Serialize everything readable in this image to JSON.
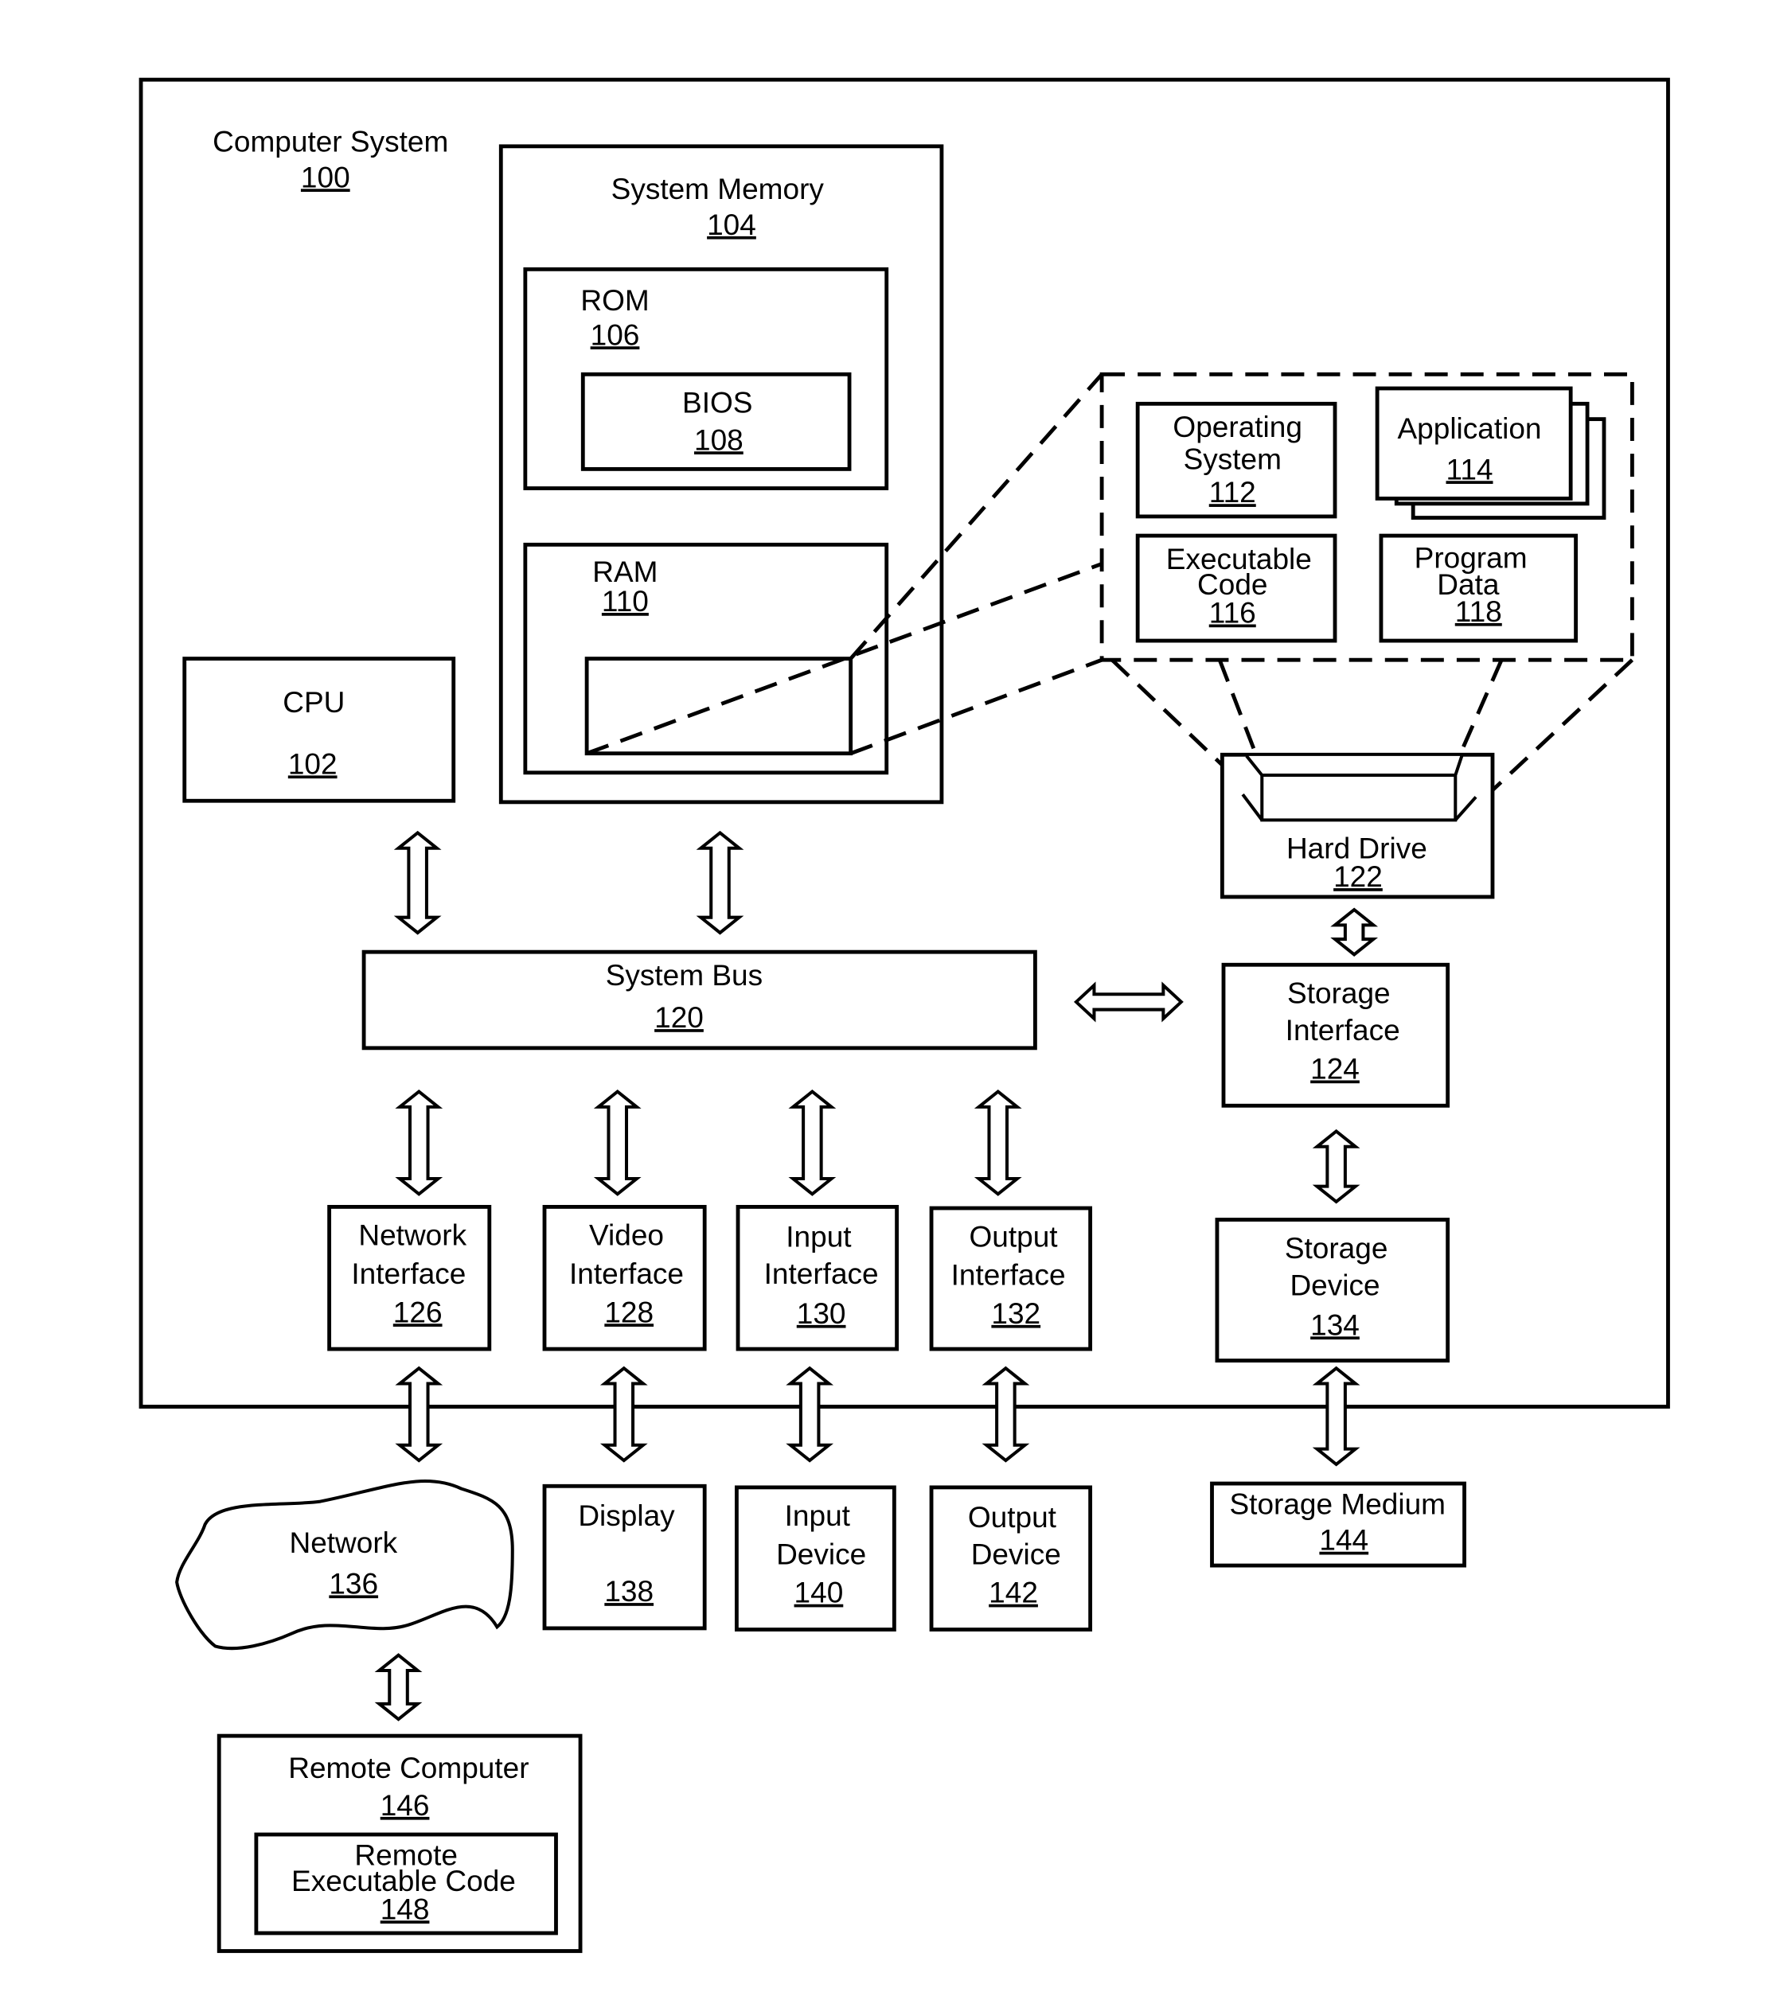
{
  "computer_system": {
    "label": "Computer System",
    "ref": "100"
  },
  "system_memory": {
    "label": "System Memory",
    "ref": "104"
  },
  "rom": {
    "label": "ROM",
    "ref": "106"
  },
  "bios": {
    "label": "BIOS",
    "ref": "108"
  },
  "ram": {
    "label": "RAM",
    "ref": "110"
  },
  "cpu": {
    "label": "CPU",
    "ref": "102"
  },
  "operating_system": {
    "line1": "Operating",
    "line2": "System",
    "ref": "112"
  },
  "application": {
    "label": "Application",
    "ref": "114"
  },
  "executable_code": {
    "line1": "Executable",
    "line2": "Code",
    "ref": "116"
  },
  "program_data": {
    "line1": "Program",
    "line2": "Data",
    "ref": "118"
  },
  "system_bus": {
    "label": "System Bus",
    "ref": "120"
  },
  "hard_drive": {
    "label": "Hard Drive",
    "ref": "122"
  },
  "storage_interface": {
    "line1": "Storage",
    "line2": "Interface",
    "ref": "124"
  },
  "network_interface": {
    "line1": "Network",
    "line2": "Interface",
    "ref": "126"
  },
  "video_interface": {
    "line1": "Video",
    "line2": "Interface",
    "ref": "128"
  },
  "input_interface": {
    "line1": "Input",
    "line2": "Interface",
    "ref": "130"
  },
  "output_interface": {
    "line1": "Output",
    "line2": "Interface",
    "ref": "132"
  },
  "storage_device": {
    "line1": "Storage",
    "line2": "Device",
    "ref": "134"
  },
  "network": {
    "label": "Network",
    "ref": "136"
  },
  "display": {
    "label": "Display",
    "ref": "138"
  },
  "input_device": {
    "line1": "Input",
    "line2": "Device",
    "ref": "140"
  },
  "output_device": {
    "line1": "Output",
    "line2": "Device",
    "ref": "142"
  },
  "storage_medium": {
    "label": "Storage Medium",
    "ref": "144"
  },
  "remote_computer": {
    "label": "Remote Computer",
    "ref": "146"
  },
  "remote_executable_code": {
    "line1": "Remote",
    "line2": "Executable Code",
    "ref": "148"
  }
}
